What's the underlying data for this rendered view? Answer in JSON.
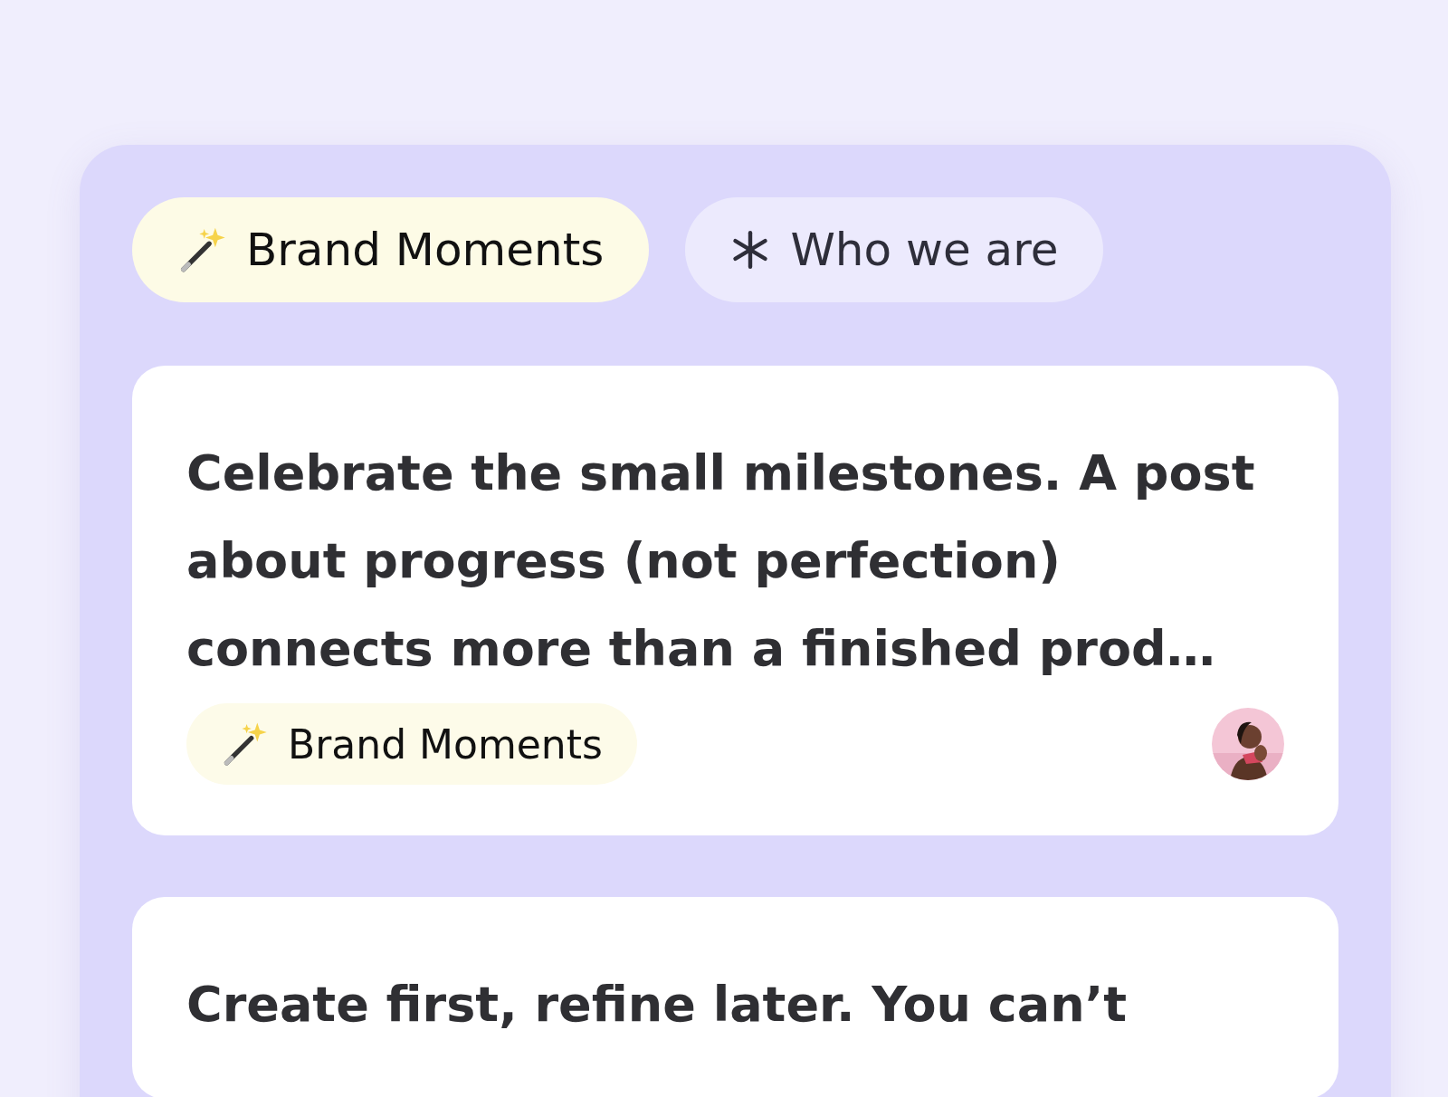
{
  "tabs": [
    {
      "label": "Brand Moments",
      "kind": "wand",
      "selected": true
    },
    {
      "label": "Who we are",
      "kind": "asterisk",
      "selected": false
    }
  ],
  "cards": [
    {
      "text": "Celebrate the small milestones. A post about progress (not perfection) connects more than a finished prod…",
      "tag": {
        "label": "Brand Moments",
        "kind": "wand"
      }
    },
    {
      "text": "Create first, refine later. You can’t"
    }
  ]
}
